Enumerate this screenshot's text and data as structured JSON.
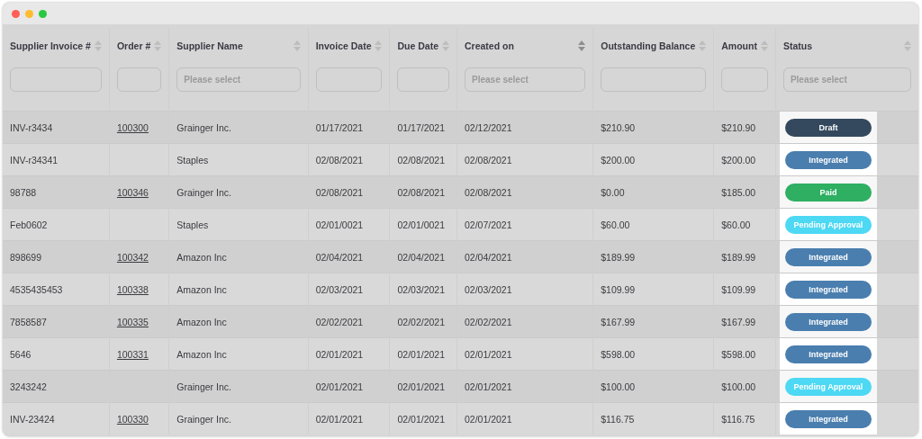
{
  "window": {
    "controls": [
      {
        "kind": "close"
      },
      {
        "kind": "minimize"
      },
      {
        "kind": "maximize"
      }
    ]
  },
  "table": {
    "columns": [
      {
        "label": "Supplier Invoice #",
        "filter": {
          "kind": "input"
        },
        "sorted": false
      },
      {
        "label": "Order #",
        "filter": {
          "kind": "input"
        },
        "sorted": false
      },
      {
        "label": "Supplier Name",
        "filter": {
          "kind": "select",
          "placeholder": "Please select"
        },
        "sorted": false
      },
      {
        "label": "Invoice Date",
        "filter": {
          "kind": "input"
        },
        "sorted": false
      },
      {
        "label": "Due Date",
        "filter": {
          "kind": "input"
        },
        "sorted": false
      },
      {
        "label": "Created on",
        "filter": {
          "kind": "select",
          "placeholder": "Please select"
        },
        "sorted": true
      },
      {
        "label": "Outstanding Balance",
        "filter": {
          "kind": "input"
        },
        "sorted": false
      },
      {
        "label": "Amount",
        "filter": {
          "kind": "input"
        },
        "sorted": false
      },
      {
        "label": "Status",
        "filter": {
          "kind": "select",
          "placeholder": "Please select"
        },
        "sorted": false,
        "highlighted": true
      }
    ],
    "rows": [
      {
        "invoice": "INV-r3434",
        "order": "100300",
        "supplier": "Grainger Inc.",
        "invoice_date": "01/17/2021",
        "due_date": "01/17/2021",
        "created_on": "02/12/2021",
        "balance": "$210.90",
        "amount": "$210.90",
        "status": {
          "label": "Draft",
          "color": "#34495e"
        }
      },
      {
        "invoice": "INV-r34341",
        "supplier": "Staples",
        "invoice_date": "02/08/2021",
        "due_date": "02/08/2021",
        "created_on": "02/08/2021",
        "balance": "$200.00",
        "amount": "$200.00",
        "status": {
          "label": "Integrated",
          "color": "#4a7eae"
        }
      },
      {
        "invoice": "98788",
        "order": "100346",
        "supplier": "Grainger Inc.",
        "invoice_date": "02/08/2021",
        "due_date": "02/08/2021",
        "created_on": "02/08/2021",
        "balance": "$0.00",
        "amount": "$185.00",
        "status": {
          "label": "Paid",
          "color": "#2eaf62"
        }
      },
      {
        "invoice": "Feb0602",
        "supplier": "Staples",
        "invoice_date": "02/01/0021",
        "due_date": "02/01/0021",
        "created_on": "02/07/2021",
        "balance": "$60.00",
        "amount": "$60.00",
        "status": {
          "label": "Pending Approval",
          "color": "#4dd8f4"
        }
      },
      {
        "invoice": "898699",
        "order": "100342",
        "supplier": "Amazon Inc",
        "invoice_date": "02/04/2021",
        "due_date": "02/04/2021",
        "created_on": "02/04/2021",
        "balance": "$189.99",
        "amount": "$189.99",
        "status": {
          "label": "Integrated",
          "color": "#4a7eae"
        }
      },
      {
        "invoice": "4535435453",
        "order": "100338",
        "supplier": "Amazon Inc",
        "invoice_date": "02/03/2021",
        "due_date": "02/03/2021",
        "created_on": "02/03/2021",
        "balance": "$109.99",
        "amount": "$109.99",
        "status": {
          "label": "Integrated",
          "color": "#4a7eae"
        }
      },
      {
        "invoice": "7858587",
        "order": "100335",
        "supplier": "Amazon Inc",
        "invoice_date": "02/02/2021",
        "due_date": "02/02/2021",
        "created_on": "02/02/2021",
        "balance": "$167.99",
        "amount": "$167.99",
        "status": {
          "label": "Integrated",
          "color": "#4a7eae"
        }
      },
      {
        "invoice": "5646",
        "order": "100331",
        "supplier": "Amazon Inc",
        "invoice_date": "02/01/2021",
        "due_date": "02/01/2021",
        "created_on": "02/01/2021",
        "balance": "$598.00",
        "amount": "$598.00",
        "status": {
          "label": "Integrated",
          "color": "#4a7eae"
        }
      },
      {
        "invoice": "3243242",
        "supplier": "Grainger Inc.",
        "invoice_date": "02/01/2021",
        "due_date": "02/01/2021",
        "created_on": "02/01/2021",
        "balance": "$100.00",
        "amount": "$100.00",
        "status": {
          "label": "Pending Approval",
          "color": "#4dd8f4"
        }
      },
      {
        "invoice": "INV-23424",
        "order": "100330",
        "supplier": "Grainger Inc.",
        "invoice_date": "02/01/2021",
        "due_date": "02/01/2021",
        "created_on": "02/01/2021",
        "balance": "$116.75",
        "amount": "$116.75",
        "status": {
          "label": "Integrated",
          "color": "#4a7eae"
        }
      }
    ]
  }
}
